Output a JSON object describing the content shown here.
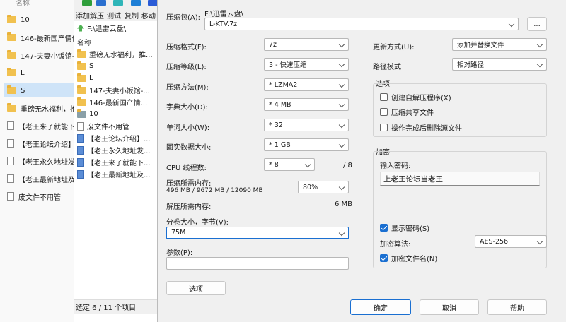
{
  "explorer": {
    "header": "名称",
    "items": [
      {
        "label": "10",
        "type": "folder"
      },
      {
        "label": "146-最新国产情侣",
        "type": "folder"
      },
      {
        "label": "147-夫妻小饭馆-",
        "type": "folder"
      },
      {
        "label": "L",
        "type": "folder"
      },
      {
        "label": "S",
        "type": "folder",
        "selected": true
      },
      {
        "label": "重磅无水福利，推",
        "type": "folder"
      },
      {
        "label": "【老王来了就能下",
        "type": "file"
      },
      {
        "label": "【老王论坛介绍】",
        "type": "file"
      },
      {
        "label": "【老王永久地址发",
        "type": "file"
      },
      {
        "label": "【老王最新地址及",
        "type": "file"
      },
      {
        "label": "废文件不用管",
        "type": "file"
      }
    ]
  },
  "sevenzip": {
    "toolbar": [
      "添加",
      "解压",
      "测试",
      "复制",
      "移动"
    ],
    "toolbar_colors": [
      "#2e9e3a",
      "#2a6fcf",
      "#2fb5b8",
      "#1e7fd6",
      "#2a5bd6"
    ],
    "path": "F:\\迅雷云盘\\",
    "column_header": "名称",
    "items": [
      {
        "label": "重磅无水福利，推...",
        "type": "folder"
      },
      {
        "label": "S",
        "type": "folder"
      },
      {
        "label": "L",
        "type": "folder"
      },
      {
        "label": "147-夫妻小饭馆-...",
        "type": "folder"
      },
      {
        "label": "146-最新国产情...",
        "type": "folder"
      },
      {
        "label": "10",
        "type": "folder-gray"
      },
      {
        "label": "废文件不用管",
        "type": "file"
      },
      {
        "label": "【老王论坛介绍】...",
        "type": "file-blue"
      },
      {
        "label": "【老王永久地址发...",
        "type": "file-blue"
      },
      {
        "label": "【老王来了就能下...",
        "type": "file-blue"
      },
      {
        "label": "【老王最新地址及...",
        "type": "file-blue"
      }
    ],
    "status": "选定 6 / 11 个项目"
  },
  "dialog": {
    "archive_label": "压缩包(A):",
    "archive_dir": "F:\\迅雷云盘\\",
    "archive_name": "L-KTV.7z",
    "browse_label": "...",
    "format_label": "压缩格式(F):",
    "format_value": "7z",
    "level_label": "压缩等级(L):",
    "level_value": "3 - 快速压缩",
    "method_label": "压缩方法(M):",
    "method_value": "* LZMA2",
    "dict_label": "字典大小(D):",
    "dict_value": "* 4 MB",
    "word_label": "单词大小(W):",
    "word_value": "* 32",
    "solid_label": "固实数据大小:",
    "solid_value": "* 1 GB",
    "threads_label": "CPU 线程数:",
    "threads_value": "* 8",
    "threads_total": "/ 8",
    "mem_label": "压缩所需内存:",
    "mem_detail": "496 MB / 9672 MB / 12090 MB",
    "mem_percent": "80%",
    "decomp_label": "解压所需内存:",
    "decomp_value": "6 MB",
    "volume_label": "分卷大小，字节(V):",
    "volume_value": "75M",
    "params_label": "参数(P):",
    "params_value": "",
    "options_button": "选项",
    "update_label": "更新方式(U):",
    "update_value": "添加并替换文件",
    "pathmode_label": "路径模式",
    "pathmode_value": "相对路径",
    "options_group": "选项",
    "opt_sfx": "创建自解压程序(X)",
    "opt_shared": "压缩共享文件",
    "opt_delete": "操作完成后删除源文件",
    "enc_group": "加密",
    "enc_input_label": "输入密码:",
    "enc_password": "上老王论坛当老王",
    "show_password": "显示密码(S)",
    "enc_method_label": "加密算法:",
    "enc_method_value": "AES-256",
    "enc_filenames": "加密文件名(N)",
    "ok": "确定",
    "cancel": "取消",
    "help": "帮助"
  }
}
